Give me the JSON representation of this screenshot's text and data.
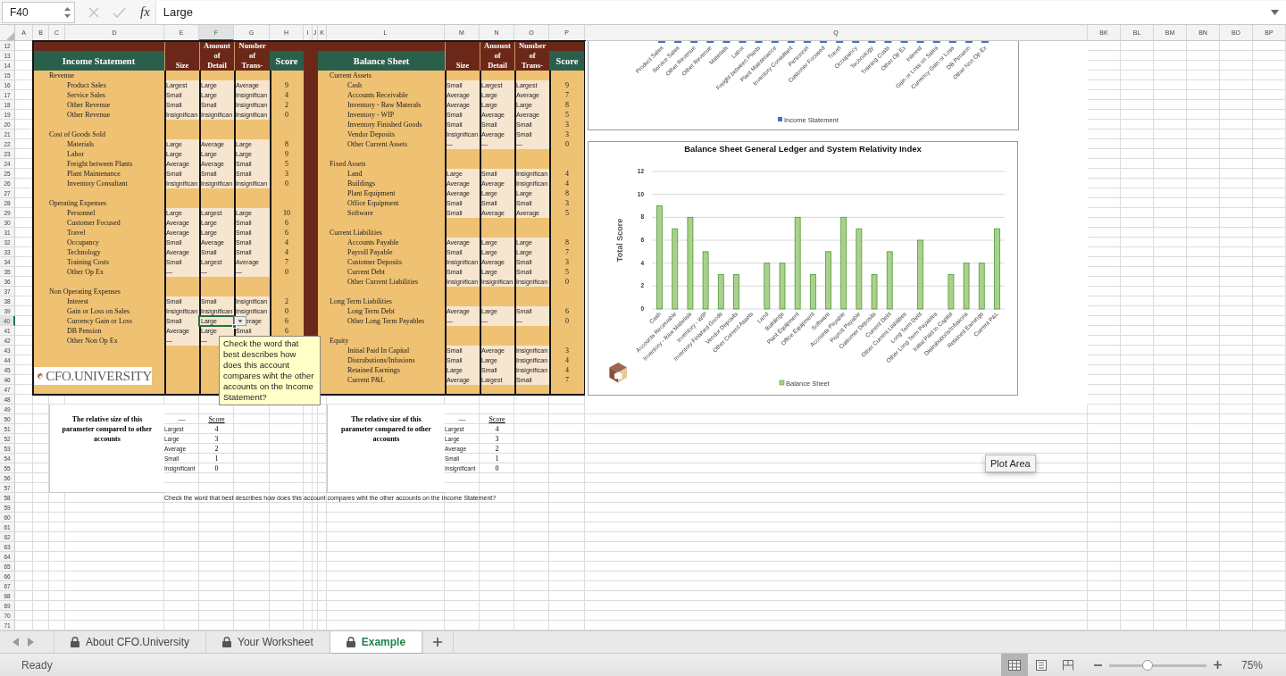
{
  "formula_bar": {
    "name_box": "F40",
    "function_label": "fx",
    "value": "Large"
  },
  "columns": [
    {
      "label": "A",
      "selected": false
    },
    {
      "label": "B",
      "selected": false
    },
    {
      "label": "C",
      "selected": false
    },
    {
      "label": "D",
      "selected": false
    },
    {
      "label": "E",
      "selected": false
    },
    {
      "label": "F",
      "selected": true
    },
    {
      "label": "G",
      "selected": false
    },
    {
      "label": "H",
      "selected": false
    },
    {
      "label": "I",
      "selected": false
    },
    {
      "label": "J",
      "selected": false
    },
    {
      "label": "K",
      "selected": false
    },
    {
      "label": "L",
      "selected": false
    },
    {
      "label": "M",
      "selected": false
    },
    {
      "label": "N",
      "selected": false
    },
    {
      "label": "O",
      "selected": false
    },
    {
      "label": "P",
      "selected": false
    },
    {
      "label": "Q",
      "selected": false
    },
    {
      "label": "BK",
      "selected": false
    },
    {
      "label": "BL",
      "selected": false
    },
    {
      "label": "BM",
      "selected": false
    },
    {
      "label": "BN",
      "selected": false
    },
    {
      "label": "BO",
      "selected": false
    },
    {
      "label": "BP",
      "selected": false
    }
  ],
  "rows": [
    {
      "label": "12",
      "selected": false
    },
    {
      "label": "13",
      "selected": false
    },
    {
      "label": "14",
      "selected": false
    },
    {
      "label": "15",
      "selected": false
    },
    {
      "label": "16",
      "selected": false
    },
    {
      "label": "17",
      "selected": false
    },
    {
      "label": "18",
      "selected": false
    },
    {
      "label": "19",
      "selected": false
    },
    {
      "label": "20",
      "selected": false
    },
    {
      "label": "21",
      "selected": false
    },
    {
      "label": "22",
      "selected": false
    },
    {
      "label": "23",
      "selected": false
    },
    {
      "label": "24",
      "selected": false
    },
    {
      "label": "25",
      "selected": false
    },
    {
      "label": "26",
      "selected": false
    },
    {
      "label": "27",
      "selected": false
    },
    {
      "label": "28",
      "selected": false
    },
    {
      "label": "29",
      "selected": false
    },
    {
      "label": "30",
      "selected": false
    },
    {
      "label": "31",
      "selected": false
    },
    {
      "label": "32",
      "selected": false
    },
    {
      "label": "33",
      "selected": false
    },
    {
      "label": "34",
      "selected": false
    },
    {
      "label": "35",
      "selected": false
    },
    {
      "label": "36",
      "selected": false
    },
    {
      "label": "37",
      "selected": false
    },
    {
      "label": "38",
      "selected": false
    },
    {
      "label": "39",
      "selected": false
    },
    {
      "label": "40",
      "selected": true
    },
    {
      "label": "41",
      "selected": false
    },
    {
      "label": "42",
      "selected": false
    },
    {
      "label": "43",
      "selected": false
    },
    {
      "label": "44",
      "selected": false
    },
    {
      "label": "45",
      "selected": false
    },
    {
      "label": "46",
      "selected": false
    },
    {
      "label": "47",
      "selected": false
    },
    {
      "label": "48",
      "selected": false
    },
    {
      "label": "49",
      "selected": false
    },
    {
      "label": "50",
      "selected": false
    },
    {
      "label": "51",
      "selected": false
    },
    {
      "label": "52",
      "selected": false
    },
    {
      "label": "53",
      "selected": false
    },
    {
      "label": "54",
      "selected": false
    },
    {
      "label": "55",
      "selected": false
    },
    {
      "label": "56",
      "selected": false
    },
    {
      "label": "57",
      "selected": false
    },
    {
      "label": "58",
      "selected": false
    },
    {
      "label": "59",
      "selected": false
    },
    {
      "label": "60",
      "selected": false
    },
    {
      "label": "61",
      "selected": false
    },
    {
      "label": "62",
      "selected": false
    },
    {
      "label": "63",
      "selected": false
    },
    {
      "label": "64",
      "selected": false
    },
    {
      "label": "65",
      "selected": false
    },
    {
      "label": "66",
      "selected": false
    },
    {
      "label": "67",
      "selected": false
    },
    {
      "label": "68",
      "selected": false
    },
    {
      "label": "69",
      "selected": false
    },
    {
      "label": "70",
      "selected": false
    },
    {
      "label": "71",
      "selected": false
    }
  ],
  "income_statement": {
    "title": "Income Statement",
    "columns": [
      "Size",
      "Amount of Detail",
      "Number of Trans-"
    ],
    "score_header": "Score",
    "logo": "CFO.UNIVERSITY",
    "sections": [
      {
        "title": "Revenue",
        "items": [
          {
            "name": "Product Sales",
            "values": [
              "Largest",
              "Large",
              "Average"
            ],
            "score": "9",
            "selected": false
          },
          {
            "name": "Service Sales",
            "values": [
              "Small",
              "Large",
              "Insignifican"
            ],
            "score": "4",
            "selected": false
          },
          {
            "name": "Other Revenue",
            "values": [
              "Small",
              "Small",
              "Insignifican"
            ],
            "score": "2",
            "selected": false
          },
          {
            "name": "Other Revenue",
            "values": [
              "Insignifican",
              "Insignifican",
              "Insignifican"
            ],
            "score": "0",
            "selected": false
          }
        ]
      },
      {
        "title": "Cost of Goods Sold",
        "items": [
          {
            "name": "Materials",
            "values": [
              "Large",
              "Average",
              "Large"
            ],
            "score": "8",
            "selected": false
          },
          {
            "name": "Labor",
            "values": [
              "Large",
              "Large",
              "Large"
            ],
            "score": "9",
            "selected": false
          },
          {
            "name": "Freight between Plants",
            "values": [
              "Average",
              "Average",
              "Small"
            ],
            "score": "5",
            "selected": false
          },
          {
            "name": "Plant Maintenance",
            "values": [
              "Small",
              "Small",
              "Small"
            ],
            "score": "3",
            "selected": false
          },
          {
            "name": "Inventory Consultant",
            "values": [
              "Insignifican",
              "Insignifican",
              "Insignifican"
            ],
            "score": "0",
            "selected": false
          }
        ]
      },
      {
        "title": "Operating Expenses",
        "items": [
          {
            "name": "Personnel",
            "values": [
              "Large",
              "Largest",
              "Large"
            ],
            "score": "10",
            "selected": false
          },
          {
            "name": "Customer Focused",
            "values": [
              "Average",
              "Large",
              "Small"
            ],
            "score": "6",
            "selected": false
          },
          {
            "name": "Travel",
            "values": [
              "Average",
              "Large",
              "Small"
            ],
            "score": "6",
            "selected": false
          },
          {
            "name": "Occupancy",
            "values": [
              "Small",
              "Average",
              "Small"
            ],
            "score": "4",
            "selected": false
          },
          {
            "name": "Technology",
            "values": [
              "Average",
              "Small",
              "Small"
            ],
            "score": "4",
            "selected": false
          },
          {
            "name": "Training Costs",
            "values": [
              "Small",
              "Largest",
              "Average"
            ],
            "score": "7",
            "selected": false
          },
          {
            "name": "Other Op Ex",
            "values": [
              "—",
              "—",
              "—"
            ],
            "score": "0",
            "selected": false
          }
        ]
      },
      {
        "title": "Non Operating Expenses",
        "items": [
          {
            "name": "Interest",
            "values": [
              "Small",
              "Small",
              "Insignifican"
            ],
            "score": "2",
            "selected": false
          },
          {
            "name": "Gain or Loss on Sales",
            "values": [
              "Insignifican",
              "Insignifican",
              "Insignifican"
            ],
            "score": "0",
            "selected": false
          },
          {
            "name": "Currency Gain or Loss",
            "values": [
              "Small",
              "Large",
              "erage"
            ],
            "score": "6",
            "selected": true
          },
          {
            "name": "DB Pension",
            "values": [
              "Average",
              "Large",
              "Small"
            ],
            "score": "6",
            "selected": false
          },
          {
            "name": "Other Non Op Ex",
            "values": [
              "—",
              "—"
            ],
            "selected": false
          }
        ]
      }
    ]
  },
  "balance_sheet": {
    "title": "Balance Sheet",
    "columns": [
      "Size",
      "Amount of Detail",
      "Number of Trans-"
    ],
    "score_header": "Score",
    "sections": [
      {
        "title": "Current Assets",
        "items": [
          {
            "name": "Cash",
            "values": [
              "Small",
              "Largest",
              "Largest"
            ],
            "score": "9",
            "selected": false
          },
          {
            "name": "Accounts Receivable",
            "values": [
              "Average",
              "Large",
              "Average"
            ],
            "score": "7",
            "selected": false
          },
          {
            "name": "Inventory - Raw Materals",
            "values": [
              "Average",
              "Large",
              "Large"
            ],
            "score": "8",
            "selected": false
          },
          {
            "name": "Inventory - WIP",
            "values": [
              "Small",
              "Average",
              "Average"
            ],
            "score": "5",
            "selected": false
          },
          {
            "name": "Inventory Finished Goods",
            "values": [
              "Small",
              "Small",
              "Small"
            ],
            "score": "3",
            "selected": false
          },
          {
            "name": "Vendor Deposits",
            "values": [
              "Insignifican",
              "Average",
              "Small"
            ],
            "score": "3",
            "selected": false
          },
          {
            "name": "Other Current Assets",
            "values": [
              "—",
              "—",
              "—"
            ],
            "score": "0",
            "selected": false
          }
        ]
      },
      {
        "title": "Fixed Assets",
        "items": [
          {
            "name": "Land",
            "values": [
              "Large",
              "Small",
              "Insignifican"
            ],
            "score": "4",
            "selected": false
          },
          {
            "name": "Buildings",
            "values": [
              "Average",
              "Average",
              "Insignifican"
            ],
            "score": "4",
            "selected": false
          },
          {
            "name": "Plant Equipment",
            "values": [
              "Average",
              "Large",
              "Large"
            ],
            "score": "8",
            "selected": false
          },
          {
            "name": "Office Equipment",
            "values": [
              "Small",
              "Small",
              "Small"
            ],
            "score": "3",
            "selected": false
          },
          {
            "name": "Software",
            "values": [
              "Small",
              "Average",
              "Average"
            ],
            "score": "5",
            "selected": false
          }
        ]
      },
      {
        "title": "Current Liabilities",
        "items": [
          {
            "name": "Accounts Payable",
            "values": [
              "Average",
              "Large",
              "Large"
            ],
            "score": "8",
            "selected": false
          },
          {
            "name": "Payroll Payable",
            "values": [
              "Small",
              "Large",
              "Large"
            ],
            "score": "7",
            "selected": false
          },
          {
            "name": "Customer Deposits",
            "values": [
              "Insignifican",
              "Average",
              "Small"
            ],
            "score": "3",
            "selected": false
          },
          {
            "name": "Current Debt",
            "values": [
              "Small",
              "Large",
              "Small"
            ],
            "score": "5",
            "selected": false
          },
          {
            "name": "Other Current Liabilities",
            "values": [
              "Insignifican",
              "Insignifican",
              "Insignifican"
            ],
            "score": "0",
            "selected": false
          }
        ]
      },
      {
        "title": "Long Term Liabilities",
        "items": [
          {
            "name": "Long Term Debt",
            "values": [
              "Average",
              "Large",
              "Small"
            ],
            "score": "6",
            "selected": false
          },
          {
            "name": "Other Long Term Payables",
            "values": [
              "—",
              "—",
              "—"
            ],
            "score": "0",
            "selected": false
          }
        ]
      },
      {
        "title": "Equity",
        "items": [
          {
            "name": "Initial Paid In Capital",
            "values": [
              "Small",
              "Average",
              "Insignifican"
            ],
            "score": "3",
            "selected": false
          },
          {
            "name": "Distrubutions/Infusions",
            "values": [
              "Small",
              "Large",
              "Insignifican"
            ],
            "score": "4",
            "selected": false
          },
          {
            "name": "Retained Earnings",
            "values": [
              "Large",
              "Small",
              "Insignifican"
            ],
            "score": "4",
            "selected": false
          },
          {
            "name": "Current P&L",
            "values": [
              "Average",
              "Largest",
              "Small"
            ],
            "score": "7",
            "selected": false
          }
        ]
      }
    ]
  },
  "charts": {
    "income": {
      "categories": [
        "Product Sales",
        "Service Sales",
        "Other Revenue",
        "Other Revenue",
        "Materials",
        "Labor",
        "Freight between Plants",
        "Plant Maintenance",
        "Inventory Consultant",
        "Personnel",
        "Customer Focused",
        "Travel",
        "Occupancy",
        "Technology",
        "Training Costs",
        "Other Op Ex",
        "Interest",
        "Gain or Loss on Sales",
        "Currency Gain or Loss",
        "DB Pension",
        "Other Non Op Ex"
      ],
      "legend": "Income Statement"
    },
    "balance": {
      "chart_data": {
        "type": "bar",
        "title": "Balance Sheet General Ledger and System Relativity Index",
        "ylabel": "Total Score",
        "categories": [
          "Cash",
          "Accounts Receivable",
          "Inventory - Raw Materials",
          "Inventory - WIP",
          "Inventory Finished Goods",
          "Vendor Deposits",
          "Other Current Assets",
          "Land",
          "Buildings",
          "Plant Equipment",
          "Office Equipment",
          "Software",
          "Accounts Payable",
          "Payroll Payable",
          "Customer Deposits",
          "Current Debt",
          "Other Current Liabilities",
          "Long Term Debt",
          "Other Long Term Payables",
          "Initial Paid In Capital",
          "Distrubutions/Infusions",
          "Retained Earnings",
          "Current P&L"
        ],
        "series": [
          {
            "name": "Balance Sheet",
            "color": "#a9d18e",
            "values": [
              9,
              7,
              8,
              5,
              3,
              3,
              0,
              4,
              4,
              8,
              3,
              5,
              8,
              7,
              3,
              5,
              0,
              6,
              0,
              3,
              4,
              4,
              7
            ]
          }
        ],
        "ylim": [
          0,
          12
        ],
        "grid": true,
        "yticks": [
          0,
          2,
          4,
          6,
          8,
          10,
          12
        ]
      }
    }
  },
  "scale_tables": [
    {
      "caption": "The relative size of this parameter compared to other accounts",
      "dash": "—",
      "score_header": "Score",
      "rows": [
        {
          "label": "Largest",
          "score": "4"
        },
        {
          "label": "Large",
          "score": "3"
        },
        {
          "label": "Average",
          "score": "2"
        },
        {
          "label": "Small",
          "score": "1"
        },
        {
          "label": "Insignificant",
          "score": "0"
        }
      ]
    },
    {
      "caption": "The relative size of this parameter compared to other accounts",
      "dash": "—",
      "score_header": "Score",
      "rows": [
        {
          "label": "Largest",
          "score": "4"
        },
        {
          "label": "Large",
          "score": "3"
        },
        {
          "label": "Average",
          "score": "2"
        },
        {
          "label": "Small",
          "score": "1"
        },
        {
          "label": "Insignificant",
          "score": "0"
        }
      ]
    }
  ],
  "note": "Check the word that best describes how does this account compares wiht the other accounts on the Income Statement?",
  "cell_tooltip": "Check the word that best describes how does this account compares wiht the other accounts on the Income Statement?",
  "chart_tooltip": "Plot Area",
  "sheet_tabs": [
    {
      "label": "About CFO.University",
      "locked": true,
      "selected": false
    },
    {
      "label": "Your Worksheet",
      "locked": true,
      "selected": false
    },
    {
      "label": "Example",
      "locked": true,
      "selected": true
    }
  ],
  "status_bar": {
    "text": "Ready",
    "views": [
      {
        "kind": "normal",
        "selected": true
      },
      {
        "kind": "page-layout",
        "selected": false
      },
      {
        "kind": "page-break",
        "selected": false
      }
    ],
    "zoom": {
      "level": 0.38,
      "label": "75%"
    }
  }
}
